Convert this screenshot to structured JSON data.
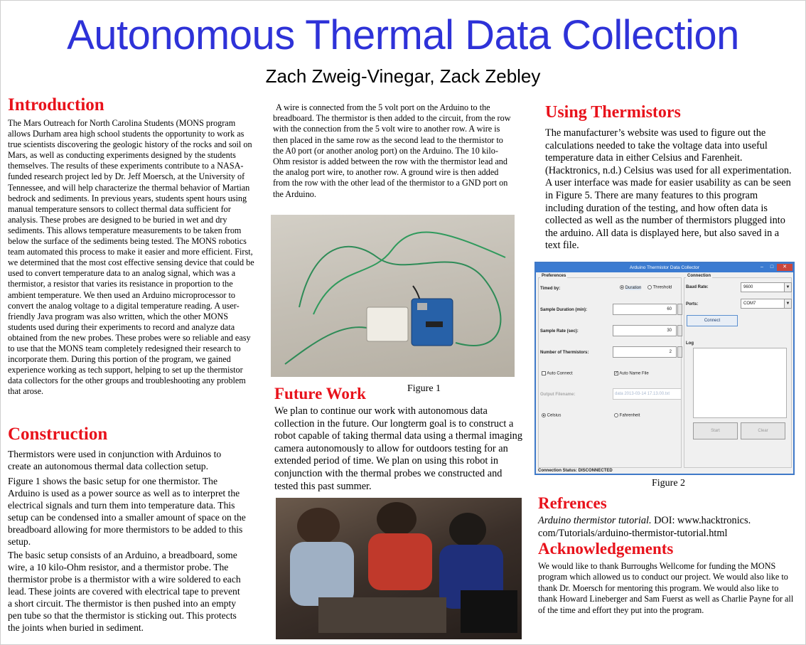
{
  "title": "Autonomous Thermal Data Collection",
  "authors": "Zach Zweig-Vinegar, Zack Zebley",
  "introduction": {
    "heading": "Introduction",
    "body": "The Mars Outreach for North Carolina Students (MONS program allows Durham area high school students the opportunity to work as true scientists discovering the geologic history of the rocks and soil on Mars, as well as conducting experiments designed by the students themselves. The results of these experiments contribute to a NASA-funded research project led by Dr. Jeff Moersch, at the University of Tennessee, and will help characterize the thermal behavior of Martian bedrock and sediments. In previous years, students spent hours using manual temperature sensors to collect thermal data sufficient for analysis. These probes are designed to be buried in wet and dry sediments. This allows temperature measurements to be taken from below the surface of the sediments being tested. The MONS robotics team automated this process to make it easier and more efficient. First, we determined that the most cost effective sensing device that could be used to convert temperature data to an analog signal, which was a thermistor, a resistor that varies its resistance in proportion to the ambient temperature. We then used an Arduino microprocessor to convert the analog voltage to a digital temperature reading. A user-friendly Java program was also written, which the other MONS students used during their experiments to record and analyze data obtained from the new probes. These probes were so reliable and easy to use that the MONS team completely redesigned their research to incorporate them. During this portion of the program, we gained experience working as tech support, helping to set up the thermistor data collectors for the other groups and troubleshooting any problem that arose."
  },
  "construction": {
    "heading": "Construction",
    "p1": "Thermistors were used in conjunction with Arduinos to create an autonomous thermal data collection setup.",
    "p2": "Figure 1 shows the basic setup for one thermistor. The Arduino is used as a power source as well as to interpret the electrical signals and turn them into temperature data. This setup can be condensed into a smaller amount of space on the breadboard allowing for more thermistors to be added to this setup.",
    "p3": "The basic setup consists of an Arduino, a breadboard, some wire, a 10 kilo-Ohm resistor, and a thermistor probe. The thermistor probe is a thermistor with a wire soldered to each lead. These joints are covered with electrical tape to prevent a short circuit. The thermistor is then pushed into an empty pen tube so that the thermistor is sticking out. This protects the joints when buried in sediment."
  },
  "wiring": {
    "body": "A wire is connected from the 5 volt port on the Arduino to the breadboard. The thermistor is then added to the circuit, from the row with the connection from the 5 volt wire to another row. A wire is then placed in the same row as the second lead to the thermistor to the A0 port (or another anolog port) on the Arduino. The 10 kilo-Ohm resistor is added between the row with the thermistor lead and the analog port wire, to another row. A ground wire is then added from the row with the other lead of the thermistor to a GND port on the Arduino."
  },
  "figure1": {
    "caption": "Figure 1"
  },
  "future_work": {
    "heading": "Future Work",
    "body": "We plan to continue our work with autonomous data collection in the future. Our longterm goal is to construct a robot capable of taking thermal data using a thermal imaging camera autonomously to allow for outdoors testing for an extended period of time. We plan on using this robot in conjunction with the thermal probes we constructed and tested this past summer."
  },
  "using_thermistors": {
    "heading": "Using Thermistors",
    "body": "The manufacturer’s website was used to figure out the calculations needed to take the voltage data into useful temperature data in either Celsius and Farenheit. (Hacktronics, n.d.) Celsius was used for all experimentation. A user interface was made for easier usability as can be seen in Figure 5. There are many features to this program including duration of the testing, and how often data is collected as well as the number of thermistors plugged into the arduino. All data is displayed here, but also saved in a text file."
  },
  "figure2": {
    "caption": "Figure 2",
    "window_title": "Arduino Thermistor Data Collector",
    "preferences_label": "Preferences",
    "connection_label": "Connection",
    "timed_by_label": "Timed by:",
    "duration_option": "Duration",
    "threshold_option": "Threshold",
    "sample_duration_label": "Sample Duration (min):",
    "sample_duration_value": "60",
    "sample_rate_label": "Sample Rate (sec):",
    "sample_rate_value": "30",
    "num_thermistors_label": "Number of Thermistors:",
    "num_thermistors_value": "2",
    "auto_connect_label": "Auto Connect",
    "auto_name_label": "Auto Name File",
    "output_filename_label": "Output Filename:",
    "output_filename_value": "data 2013-03-14 17.13.00.txt",
    "celsius_label": "Celsius",
    "fahrenheit_label": "Fahrenheit",
    "baud_rate_label": "Baud Rate:",
    "baud_rate_value": "9600",
    "ports_label": "Ports:",
    "ports_value": "COM7",
    "connect_button": "Connect",
    "log_label": "Log",
    "start_button": "Start",
    "clear_button": "Clear",
    "status_text": "Connection Status: DISCONNECTED",
    "minimize_glyph": "–",
    "maximize_glyph": "□",
    "close_glyph": "✕"
  },
  "references": {
    "heading": "Refrences",
    "title_italic": "Arduino thermistor tutorial.",
    "rest": " DOI: www.hacktronics. com/Tutorials/arduino-thermistor-tutorial.html"
  },
  "acknowledgements": {
    "heading": "Acknowledgements",
    "body": "We would like to thank Burroughs Wellcome for funding the MONS program which allowed us to conduct our project. We would also like to thank Dr. Moersch for mentoring this program. We would also like to thank Howard Lineberger and Sam Fuerst as well as Charlie Payne for all of the time and effort they put into the program."
  }
}
